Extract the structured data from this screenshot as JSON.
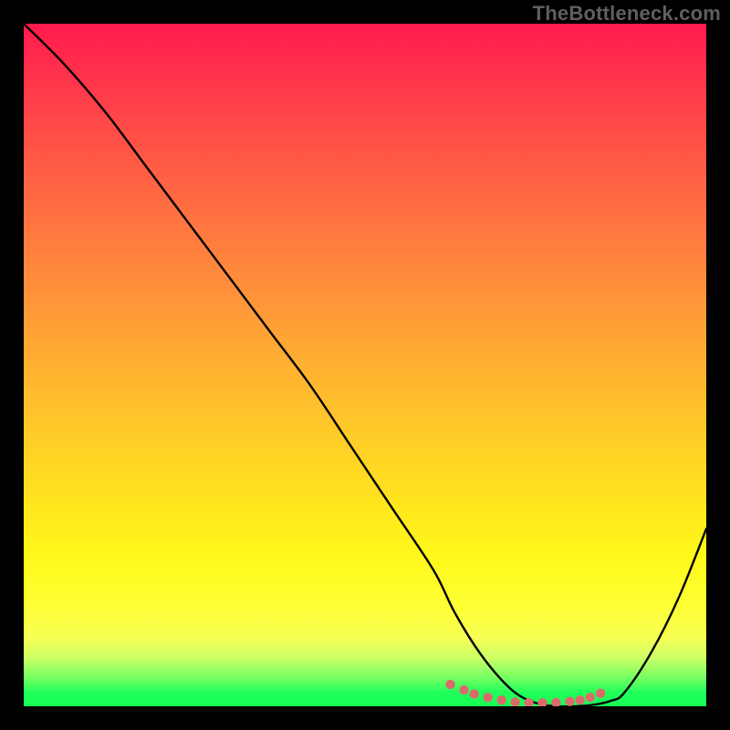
{
  "watermark": "TheBottleneck.com",
  "chart_data": {
    "type": "line",
    "title": "",
    "xlabel": "",
    "ylabel": "",
    "xlim": [
      0,
      100
    ],
    "ylim": [
      0,
      100
    ],
    "series": [
      {
        "name": "bottleneck-curve",
        "x": [
          0,
          6,
          12,
          18,
          24,
          30,
          36,
          42,
          48,
          54,
          60,
          63,
          66,
          69,
          72,
          75,
          78,
          81,
          84,
          86,
          88,
          92,
          96,
          100
        ],
        "values": [
          100,
          94,
          87,
          79,
          71,
          63,
          55,
          47,
          38,
          29,
          20,
          14,
          9,
          5,
          2,
          0.5,
          0,
          0,
          0.3,
          0.8,
          2,
          8,
          16,
          26
        ]
      },
      {
        "name": "optimal-dots",
        "x": [
          62.5,
          64.5,
          66,
          68,
          70,
          72,
          74,
          76,
          78,
          80,
          81.5,
          83,
          84.5
        ],
        "values": [
          3.2,
          2.4,
          1.8,
          1.3,
          0.9,
          0.6,
          0.5,
          0.5,
          0.55,
          0.7,
          0.9,
          1.3,
          1.9
        ]
      }
    ],
    "dot_color": "#db6b6b",
    "curve_color": "#000000"
  }
}
